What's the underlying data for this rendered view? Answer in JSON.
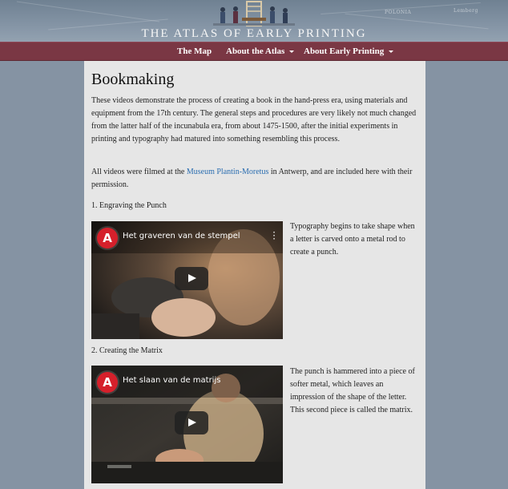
{
  "site": {
    "title": "THE ATLAS OF EARLY PRINTING",
    "map_labels": [
      "POLONIA",
      "Lemberg"
    ]
  },
  "nav": {
    "items": [
      {
        "label": "The Map",
        "has_dropdown": false
      },
      {
        "label": "About the Atlas",
        "has_dropdown": true
      },
      {
        "label": "About Early Printing",
        "has_dropdown": true
      }
    ]
  },
  "page": {
    "title": "Bookmaking",
    "intro": "These videos demonstrate the process of creating a book in the hand-press era, using materials and equipment from the 17th century. The general steps and procedures are very likely not much changed from the latter half of the incunabula era, from about 1475-1500, after the initial experiments in printing and typography had matured into something resembling this process.",
    "credit_before": "All videos were filmed at the ",
    "credit_link": "Museum Plantin-Moretus",
    "credit_after": " in Antwerp, and are included here with their permission."
  },
  "videos": [
    {
      "heading": "1. Engraving the Punch",
      "title": "Het graveren van de stempel",
      "logo": "A",
      "description": "Typography begins to take shape when a letter is carved onto a metal rod to create a punch."
    },
    {
      "heading": "2. Creating the Matrix",
      "title": "Het slaan van de matrijs",
      "logo": "A",
      "description": "The punch is hammered into a piece of softer metal, which leaves an impression of the shape of the letter. This second piece is called the matrix."
    }
  ],
  "colors": {
    "nav_bg": "#7a3744",
    "page_bg": "#8593a3",
    "content_bg": "#e6e6e6",
    "link": "#2a6db0",
    "yt_logo": "#d5202b"
  }
}
